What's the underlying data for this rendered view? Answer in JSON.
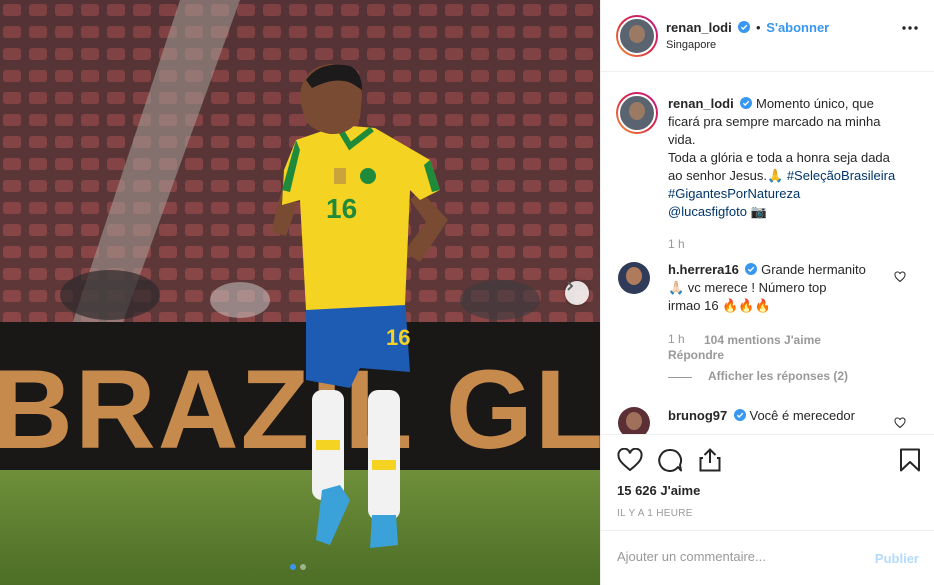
{
  "post": {
    "username": "renan_lodi",
    "follow_label": "S'abonner",
    "location": "Singapore",
    "photo_banner_text": "BRAZIL GLOBA",
    "jersey_number": "16",
    "dots_count": 2,
    "active_dot": 0
  },
  "caption": {
    "username": "renan_lodi",
    "line1": "Momento único, que",
    "line2": "ficará pra sempre marcado na minha",
    "line3": "vida.",
    "line4": "Toda a glória e toda a honra seja dada",
    "line5_text": "ao senhor Jesus.🙏",
    "line5_tag": "#SeleçãoBrasileira",
    "line6_tag": "#GigantesPorNatureza",
    "line7_tag": "@lucasfigfoto",
    "line7_emoji": "📷",
    "time": "1 h"
  },
  "comments": [
    {
      "username": "h.herrera16",
      "line1": "Grande hermanito",
      "line2": "🙏🏻 vc merece ! Número top",
      "line3": "irmao 16 🔥🔥🔥",
      "time": "1 h",
      "likes": "104 mentions J'aime",
      "reply_label": "Répondre",
      "show_replies": "Afficher les réponses (2)"
    },
    {
      "username": "brunog97",
      "line1": "Você é merecedor"
    }
  ],
  "actions": {
    "likes": "15 626 J'aime",
    "timestamp": "IL Y A 1 HEURE"
  },
  "composer": {
    "placeholder": "Ajouter un commentaire...",
    "publish_label": "Publier"
  },
  "colors": {
    "accent": "#3897f0",
    "jersey_yellow": "#f5d323",
    "jersey_green": "#1f8a3a",
    "shorts_blue": "#1e5cb3"
  }
}
